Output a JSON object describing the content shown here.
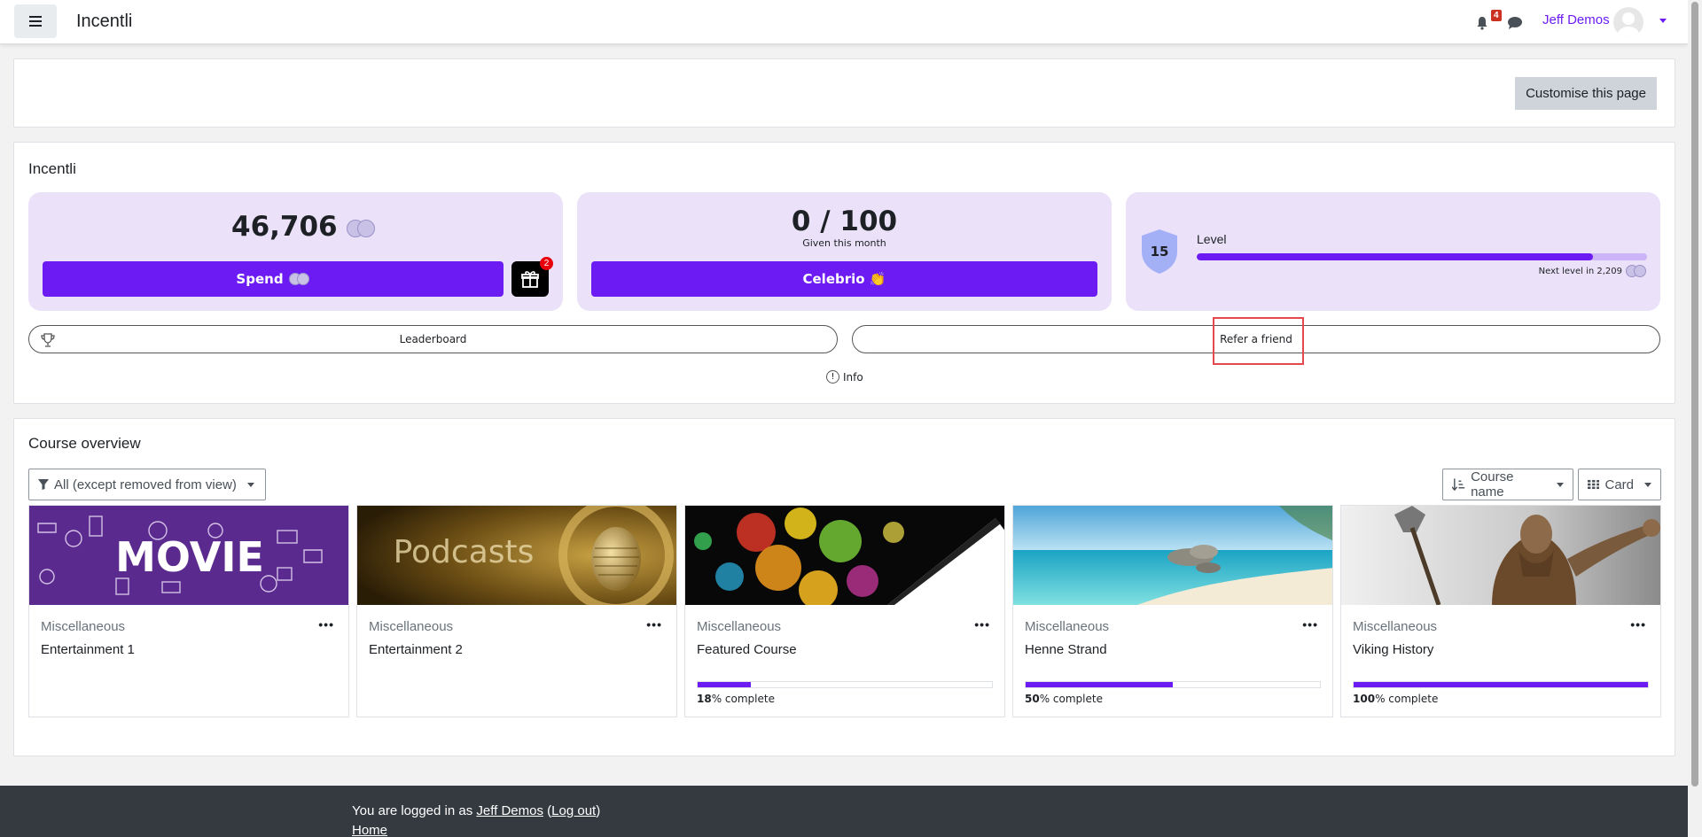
{
  "navbar": {
    "brand": "Incentli",
    "notification_count": "4",
    "username": "Jeff Demos"
  },
  "top_card": {
    "customise_label": "Customise this page"
  },
  "incentli": {
    "title": "Incentli",
    "points": "46,706",
    "spend_label": "Spend",
    "gift_badge": "2",
    "given": "0 / 100",
    "given_label": "Given this month",
    "celebrio_label": "Celebrio 👏",
    "level_number": "15",
    "level_label": "Level",
    "level_progress": 0.88,
    "next_level_text": "Next level in 2,209",
    "leaderboard_label": "Leaderboard",
    "refer_label": "Refer a friend",
    "info_label": "Info",
    "info_icon": "!"
  },
  "courses": {
    "title": "Course overview",
    "filter_label": "All (except removed from view)",
    "sort_label": "Course name",
    "view_label": "Card",
    "items": [
      {
        "category": "Miscellaneous",
        "name": "Entertainment 1",
        "image_text": "MOVIE",
        "progress": null
      },
      {
        "category": "Miscellaneous",
        "name": "Entertainment 2",
        "image_text": "Podcasts",
        "progress": null
      },
      {
        "category": "Miscellaneous",
        "name": "Featured Course",
        "image_text": "",
        "progress": 18
      },
      {
        "category": "Miscellaneous",
        "name": "Henne Strand",
        "image_text": "",
        "progress": 50
      },
      {
        "category": "Miscellaneous",
        "name": "Viking History",
        "image_text": "",
        "progress": 100
      }
    ],
    "complete_suffix": "% complete",
    "menu_glyph": "•••"
  },
  "footer": {
    "logged_in_prefix": "You are logged in as ",
    "user_link": "Jeff Demos",
    "logout_link": "Log out",
    "home_link": "Home"
  },
  "colors": {
    "accent": "#6c1bf3",
    "panel": "#ebe1f8",
    "footer": "#343a40"
  }
}
